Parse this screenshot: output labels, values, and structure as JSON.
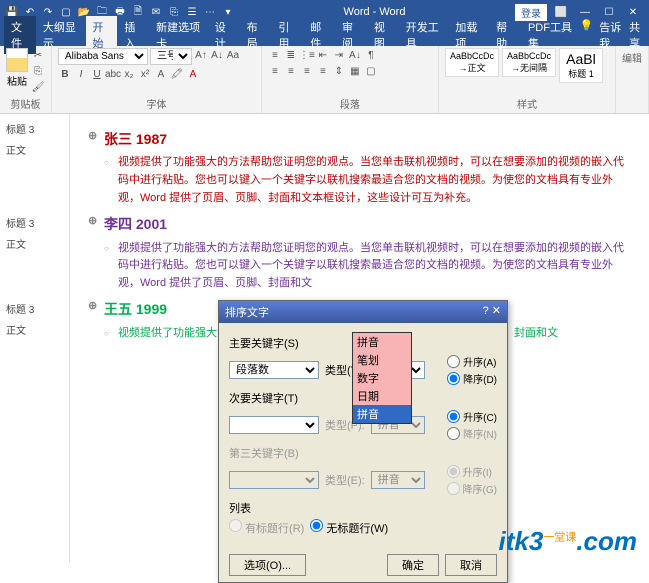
{
  "titlebar": {
    "title": "Word - Word",
    "login": "登录",
    "qat_icons": [
      "save",
      "undo",
      "redo",
      "new",
      "open",
      "print",
      "preview",
      "spellcheck",
      "copy",
      "paste",
      "more1",
      "more2",
      "dropdown"
    ]
  },
  "menubar": {
    "tabs": [
      "文件",
      "大纲显示",
      "开始",
      "插入",
      "新建选项卡",
      "设计",
      "布局",
      "引用",
      "邮件",
      "审阅",
      "视图",
      "开发工具",
      "加载项",
      "帮助",
      "PDF工具集"
    ],
    "active_index": 2,
    "tell_me": "告诉我",
    "share": "共享"
  },
  "ribbon": {
    "clipboard": {
      "label": "剪贴板",
      "paste": "粘贴"
    },
    "font": {
      "label": "字体",
      "name": "Alibaba Sans",
      "size": "三号"
    },
    "paragraph": {
      "label": "段落"
    },
    "styles": {
      "label": "样式",
      "items": [
        {
          "sample": "AaBbCcDc",
          "name": "→正文"
        },
        {
          "sample": "AaBbCcDc",
          "name": "→无间隔"
        },
        {
          "sample": "AaBl",
          "name": "标题 1"
        }
      ]
    },
    "editing": {
      "label": "编辑"
    }
  },
  "nav": {
    "items": [
      "标题 3",
      "正文",
      "标题 3",
      "正文",
      "标题 3",
      "正文"
    ]
  },
  "document": {
    "sections": [
      {
        "heading": "张三 1987",
        "hclass": "h-red",
        "pclass": "p-red",
        "body": "视频提供了功能强大的方法帮助您证明您的观点。当您单击联机视频时，可以在想要添加的视频的嵌入代码中进行粘贴。您也可以键入一个关键字以联机搜索最适合您的文档的视频。为使您的文档具有专业外观，Word 提供了页眉、页脚、封面和文本框设计，这些设计可互为补充。"
      },
      {
        "heading": "李四 2001",
        "hclass": "h-purple",
        "pclass": "p-purple",
        "body": "视频提供了功能强大的方法帮助您证明您的观点。当您单击联机视频时，可以在想要添加的视频的嵌入代码中进行粘贴。您也可以键入一个关键字以联机搜索最适合您的文档的视频。为使您的文档具有专业外观，Word 提供了页眉、页脚、封面和文"
      },
      {
        "heading": "王五 1999",
        "hclass": "h-green",
        "pclass": "p-green",
        "body": "视频提供了功能强大的方以在想要添加的视频的机搜索最适合您的文页眉、页脚、封面和文"
      }
    ]
  },
  "dialog": {
    "title": "排序文字",
    "primary_label": "主要关键字(S)",
    "primary_value": "段落数",
    "type_label": "类型(Y):",
    "type_value": "拼音",
    "type_options": [
      "拼音",
      "笔划",
      "数字",
      "日期",
      "拼音"
    ],
    "asc": "升序(A)",
    "desc": "降序(D)",
    "secondary_label": "次要关键字(T)",
    "type2_label": "类型(P):",
    "type2_value": "拼音",
    "asc2": "升序(C)",
    "desc2": "降序(N)",
    "third_label": "第三关键字(B)",
    "type3_label": "类型(E):",
    "type3_value": "拼音",
    "asc3": "升序(I)",
    "desc3": "降序(G)",
    "list_label": "列表",
    "has_header": "有标题行(R)",
    "no_header": "无标题行(W)",
    "options": "选项(O)...",
    "ok": "确定",
    "cancel": "取消"
  },
  "watermark": {
    "text": "itk3",
    "domain": ".com",
    "tag": "一堂课"
  }
}
